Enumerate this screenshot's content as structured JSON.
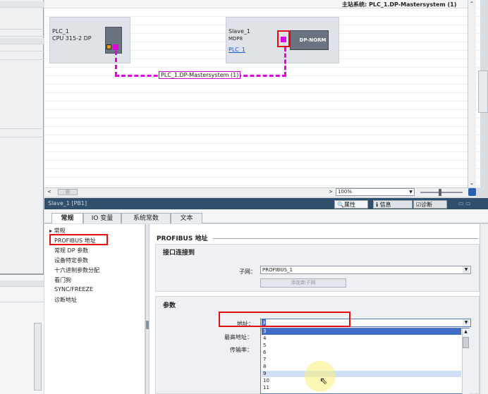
{
  "editor": {
    "master_system_label": "主站系统: PLC_1.DP-Mastersystem (1)",
    "plc": {
      "name": "PLC_1",
      "cpu": "CPU 315-2 DP"
    },
    "slave": {
      "name": "Slave_1",
      "type": "MDP8",
      "link": "PLC_1",
      "module_label": "DP-NORM"
    },
    "bus_label": "PLC_1.DP-Mastersystem (1)",
    "zoom": "100%"
  },
  "inspector": {
    "title": "Slave_1 [PB1]",
    "header_tabs": {
      "properties": "属性",
      "info": "信息",
      "diagnostics": "诊断"
    },
    "tabs": {
      "general": "常规",
      "io": "IO 变量",
      "system_constants": "系统常数",
      "text": "文本"
    },
    "nav": {
      "general": "常规",
      "items": [
        "PROFIBUS 地址",
        "常规 DP 参数",
        "设备特定参数",
        "十六进制参数分配",
        "看门狗",
        "SYNC/FREEZE",
        "诊断地址"
      ]
    },
    "content": {
      "section_title": "PROFIBUS 地址",
      "connect_group_title": "接口连接到",
      "subnet_label": "子网：",
      "subnet_value": "PROFIBUS_1",
      "add_subnet_button": "添加新子网",
      "params_group_title": "参数",
      "address_label": "地址：",
      "address_value": "3",
      "max_address_label": "最高地址：",
      "baud_label": "传输率：",
      "address_options": [
        "3",
        "4",
        "5",
        "6",
        "7",
        "8",
        "9",
        "10",
        "11"
      ],
      "selected_option_index": 0,
      "hover_option_index": 6
    }
  }
}
